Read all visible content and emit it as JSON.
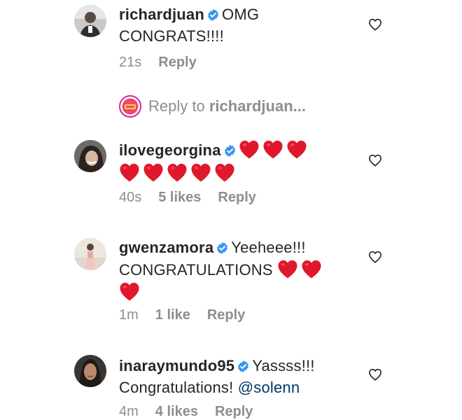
{
  "comments": [
    {
      "username": "richardjuan",
      "text_line1": "OMG",
      "text_line2": "CONGRATS!!!!",
      "time": "21s",
      "likes": "",
      "reply_label": "Reply"
    },
    {
      "username": "ilovegeorgina",
      "time": "40s",
      "likes": "5 likes",
      "reply_label": "Reply"
    },
    {
      "username": "gwenzamora",
      "text_line1": "Yeeheee!!!",
      "text_line2": "CONGRATULATIONS",
      "time": "1m",
      "likes": "1 like",
      "reply_label": "Reply"
    },
    {
      "username": "inaraymundo95",
      "text_line1": "Yassss!!!",
      "text_line2": "Congratulations!",
      "mention": "@solenn",
      "time": "4m",
      "likes": "4 likes",
      "reply_label": "Reply"
    }
  ],
  "reply_prompt": {
    "prefix": "Reply to",
    "target": "richardjuan..."
  },
  "icons": {
    "verified": "verified-badge-icon",
    "heart_emoji": "red-heart-emoji",
    "like": "heart-outline-icon"
  },
  "colors": {
    "verified_blue": "#3897f0",
    "heart_red": "#e0182b",
    "meta_gray": "#8e8e8e",
    "text": "#262626",
    "mention": "#00376b"
  }
}
